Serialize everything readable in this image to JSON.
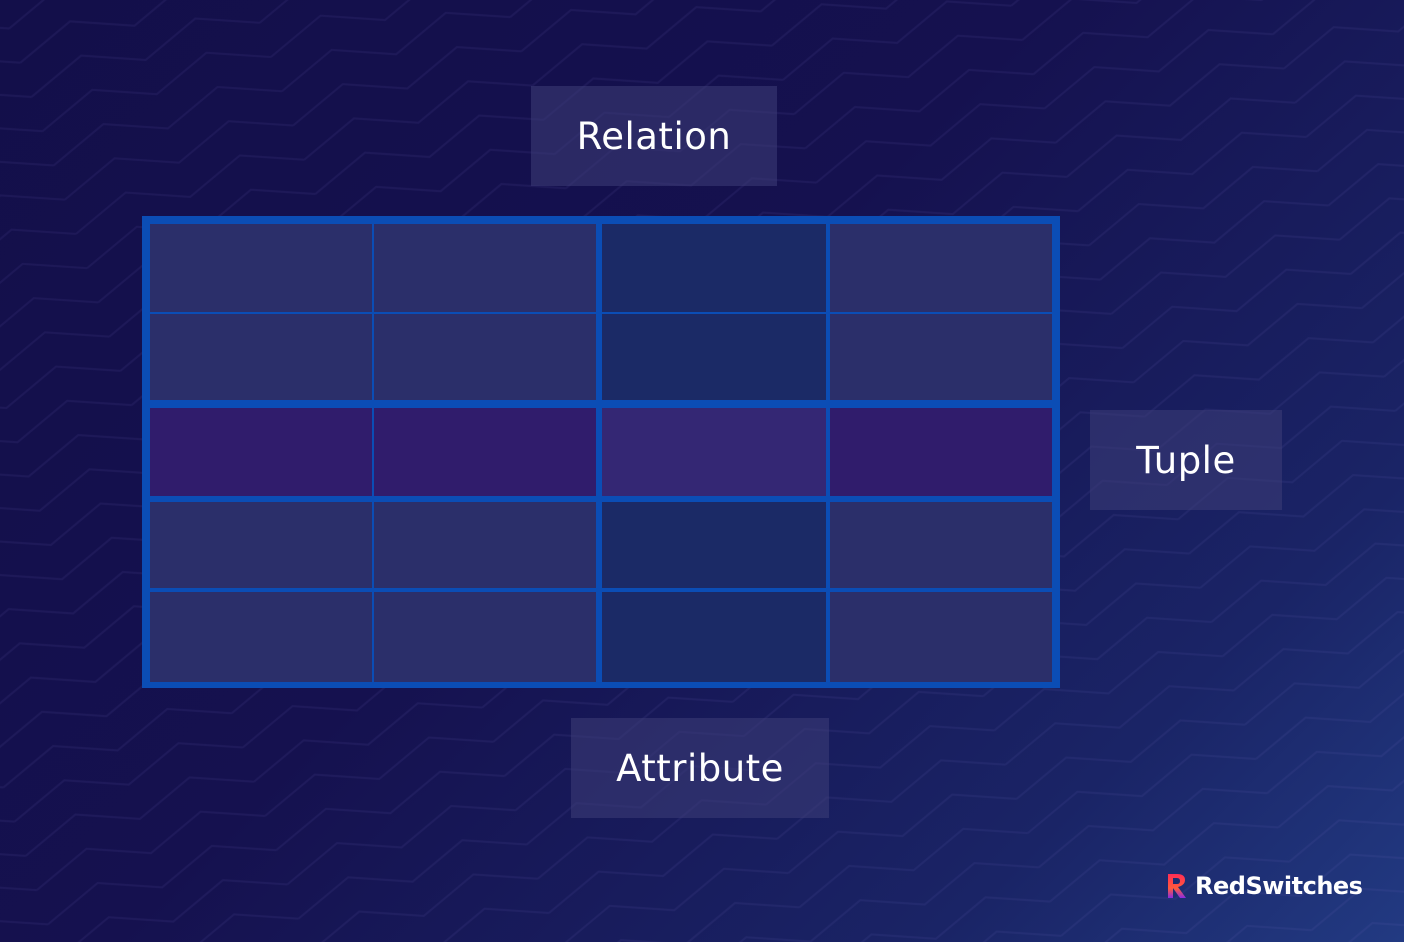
{
  "labels": {
    "relation": "Relation",
    "tuple": "Tuple",
    "attribute": "Attribute"
  },
  "table": {
    "rows": 5,
    "columns": 4,
    "highlighted_row": 3,
    "highlighted_column": 3,
    "colors": {
      "border": "#0b4db5",
      "cell": "#2b2f6a",
      "column_highlight": "#1b2a66",
      "row_highlight": "#301c6c",
      "intersection": "#342774"
    }
  },
  "brand": {
    "name": "RedSwitches",
    "icon": "redswitches-logo-icon"
  }
}
